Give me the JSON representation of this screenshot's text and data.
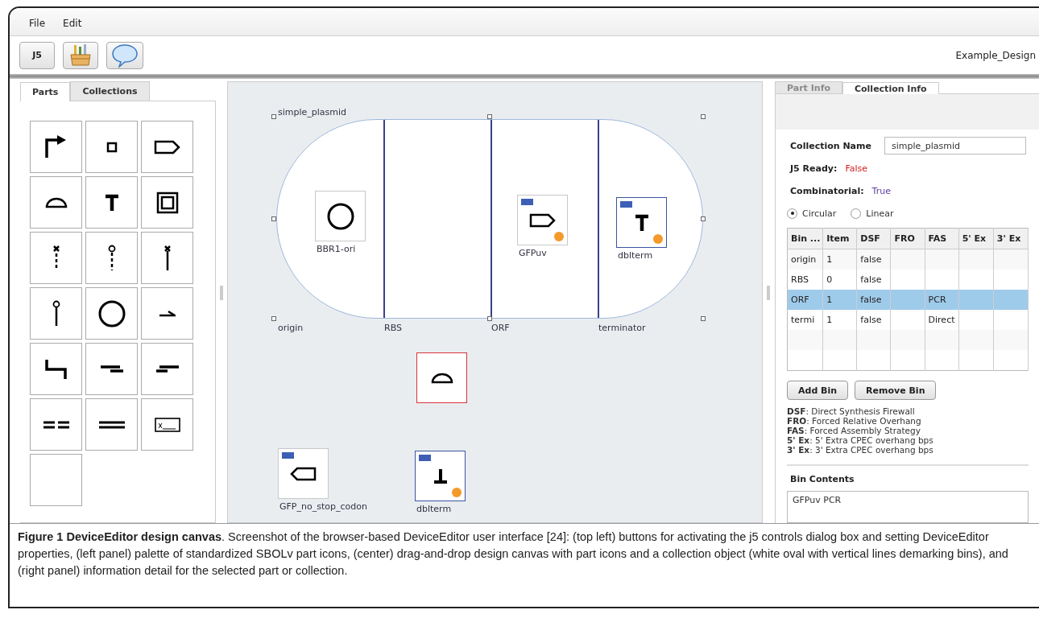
{
  "menu": [
    "File",
    "Edit"
  ],
  "toolbar": {
    "buttons": [
      {
        "kind": "text",
        "label": "J5"
      },
      {
        "kind": "basket"
      },
      {
        "kind": "bubble"
      }
    ],
    "design_name": "Example_Design"
  },
  "left_panel": {
    "tabs": [
      {
        "label": "Parts",
        "selected": true
      },
      {
        "label": "Collections",
        "selected": false
      }
    ],
    "palette": [
      {
        "kind": "promoter"
      },
      {
        "kind": "square"
      },
      {
        "kind": "cds"
      },
      {
        "kind": "rbs"
      },
      {
        "kind": "terminator"
      },
      {
        "kind": "insulator"
      },
      {
        "kind": "xdash"
      },
      {
        "kind": "pindash"
      },
      {
        "kind": "xstem"
      },
      {
        "kind": "pin"
      },
      {
        "kind": "circle"
      },
      {
        "kind": "hook"
      },
      {
        "kind": "step"
      },
      {
        "kind": "lowright"
      },
      {
        "kind": "lowleft"
      },
      {
        "kind": "dashes"
      },
      {
        "kind": "bars"
      },
      {
        "kind": "boxx"
      },
      {
        "kind": "blank"
      }
    ]
  },
  "canvas": {
    "collection": {
      "name": "simple_plasmid",
      "bins": [
        {
          "label": "origin",
          "parts": [
            {
              "name": "BBR1-ori",
              "kind": "circle",
              "color": "#c8c8c8",
              "tab": false,
              "dot": false
            }
          ]
        },
        {
          "label": "RBS"
        },
        {
          "label": "ORF",
          "parts": [
            {
              "name": "GFPuv",
              "kind": "cds",
              "color": "#c8c8c8",
              "tab": true,
              "dot": true
            }
          ]
        },
        {
          "label": "terminator",
          "parts": [
            {
              "name": "dblterm",
              "kind": "terminator",
              "color": "#3a55a0",
              "tab": true,
              "dot": true
            }
          ]
        }
      ]
    },
    "parts": [
      {
        "kind": "rbs",
        "color": "#d8343a",
        "tab": false,
        "dot": false
      },
      {
        "name": "GFP_no_stop_codon",
        "kind": "cdsrev",
        "color": "#c8c8c8",
        "tab": true,
        "dot": false
      },
      {
        "name": "dblterm",
        "kind": "termrev",
        "color": "#3a55a0",
        "tab": true,
        "dot": true
      }
    ]
  },
  "right_panel": {
    "tabs": [
      {
        "label": "Part Info",
        "selected": false,
        "disabled": true
      },
      {
        "label": "Collection Info",
        "selected": true,
        "disabled": false
      }
    ],
    "collection_name": {
      "label": "Collection Name",
      "value": "simple_plasmid"
    },
    "j5_ready": {
      "label": "J5 Ready:",
      "value": "False"
    },
    "combinatorial": {
      "label": "Combinatorial:",
      "value": "True"
    },
    "shape_options": [
      {
        "label": "Circular",
        "selected": true
      },
      {
        "label": "Linear",
        "selected": false
      }
    ],
    "table": {
      "columns": [
        "Bin ...",
        "Item",
        "DSF",
        "FRO",
        "FAS",
        "5' Ex",
        "3' Ex"
      ],
      "rows": [
        {
          "bin": "origin",
          "items": "1",
          "dsf": "false",
          "selected": false
        },
        {
          "bin": "RBS",
          "items": "0",
          "dsf": "false",
          "selected": false
        },
        {
          "bin": "ORF",
          "items": "1",
          "dsf": "false",
          "fas": "PCR",
          "selected": true
        },
        {
          "bin": "termi",
          "items": "1",
          "dsf": "false",
          "fas": "Direct",
          "selected": false
        }
      ]
    },
    "buttons": [
      "Add Bin",
      "Remove Bin"
    ],
    "legend": [
      "**DSF**: Direct Synthesis Firewall",
      "**FRO**: Forced Relative Overhang",
      "**FAS**: Forced Assembly Strategy",
      "**5' Ex**: 5' Extra CPEC overhang bps",
      "**3' Ex**: 3' Extra CPEC overhang bps"
    ],
    "bin_contents": {
      "label": "Bin Contents",
      "value": "GFPuv PCR"
    }
  },
  "caption": "**Figure 1 DeviceEditor design canvas**. Screenshot of the browser-based DeviceEditor user interface [24]: (top left) buttons for activating the j5 controls dialog box and setting DeviceEditor properties, (left panel) palette of standardized SBOLv part icons, (center) drag-and-drop design canvas with part icons and a collection object (white oval with vertical lines demarking bins), and (right panel) information detail for the selected part or collection."
}
